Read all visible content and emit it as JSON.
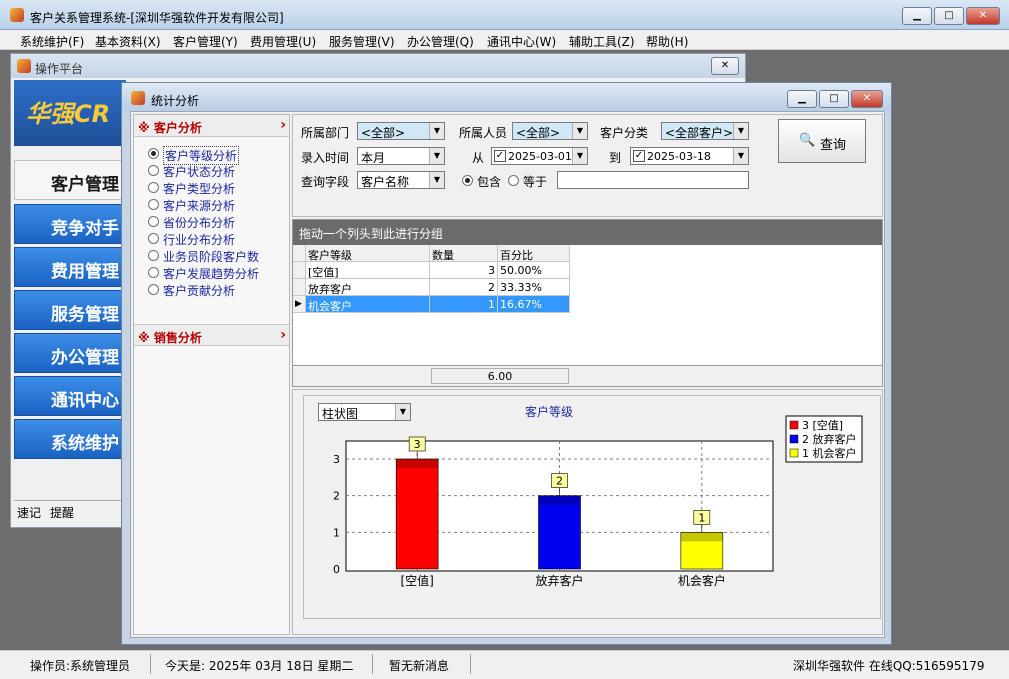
{
  "main_window": {
    "title": "客户关系管理系统-[深圳华强软件开发有限公司]",
    "controls": [
      "minimize",
      "restore",
      "close"
    ]
  },
  "menubar": {
    "items": [
      "系统维护(F)",
      "基本资料(X)",
      "客户管理(Y)",
      "费用管理(U)",
      "服务管理(V)",
      "办公管理(Q)",
      "通讯中心(W)",
      "辅助工具(Z)",
      "帮助(H)"
    ]
  },
  "operation_window": {
    "title": "操作平台",
    "banner_text": "华强CR",
    "nav_items": [
      "客户管理",
      "竞争对手",
      "费用管理",
      "服务管理",
      "办公管理",
      "通讯中心",
      "系统维护"
    ],
    "active_nav": "客户管理",
    "bottom_tabs": [
      "速记",
      "提醒"
    ]
  },
  "stat_window": {
    "title": "统计分析",
    "left_panel": {
      "customer_section": "客户分析",
      "customer_items": [
        "客户等级分析",
        "客户状态分析",
        "客户类型分析",
        "客户来源分析",
        "省份分布分析",
        "行业分布分析",
        "业务员阶段客户数",
        "客户发展趋势分析",
        "客户贡献分析"
      ],
      "selected_item": "客户等级分析",
      "sales_section": "销售分析",
      "section_marker": "※"
    },
    "query": {
      "dept_label": "所属部门",
      "dept_value": "<全部>",
      "person_label": "所属人员",
      "person_value": "<全部>",
      "category_label": "客户分类",
      "category_value": "<全部客户>",
      "time_label": "录入时间",
      "time_value": "本月",
      "from_label": "从",
      "from_date": "2025-03-01",
      "to_label": "到",
      "to_date": "2025-03-18",
      "field_label": "查询字段",
      "field_value": "客户名称",
      "contains_label": "包含",
      "equals_label": "等于",
      "search_text": "",
      "query_button": "查询"
    },
    "grid": {
      "group_hint": "拖动一个列头到此进行分组",
      "columns": [
        "客户等级",
        "数量",
        "百分比"
      ],
      "rows": [
        {
          "level": "[空值]",
          "count": "3",
          "percent": "50.00%"
        },
        {
          "level": "放弃客户",
          "count": "2",
          "percent": "33.33%"
        },
        {
          "level": "机会客户",
          "count": "1",
          "percent": "16.67%"
        }
      ],
      "selected_row": 2,
      "footer_total": "6.00"
    },
    "chart_controls": {
      "chart_type_value": "柱状图"
    }
  },
  "chart_data": {
    "type": "bar",
    "title": "客户等级",
    "categories": [
      "[空值]",
      "放弃客户",
      "机会客户"
    ],
    "values": [
      3,
      2,
      1
    ],
    "value_labels": [
      "3",
      "2",
      "1"
    ],
    "colors": [
      "#ff0000",
      "#0000ee",
      "#ffff00"
    ],
    "ylim": [
      0,
      3
    ],
    "yticks": [
      "0",
      "1",
      "2",
      "3"
    ],
    "legend": [
      "3 [空值]",
      "2 放弃客户",
      "1 机会客户"
    ],
    "legend_position": "top-right",
    "grid": true
  },
  "statusbar": {
    "operator": "操作员:系统管理员",
    "today": "今天是: 2025年 03月 18日  星期二",
    "messages": "暂无新消息",
    "company": "深圳华强软件 在线QQ:516595179"
  }
}
